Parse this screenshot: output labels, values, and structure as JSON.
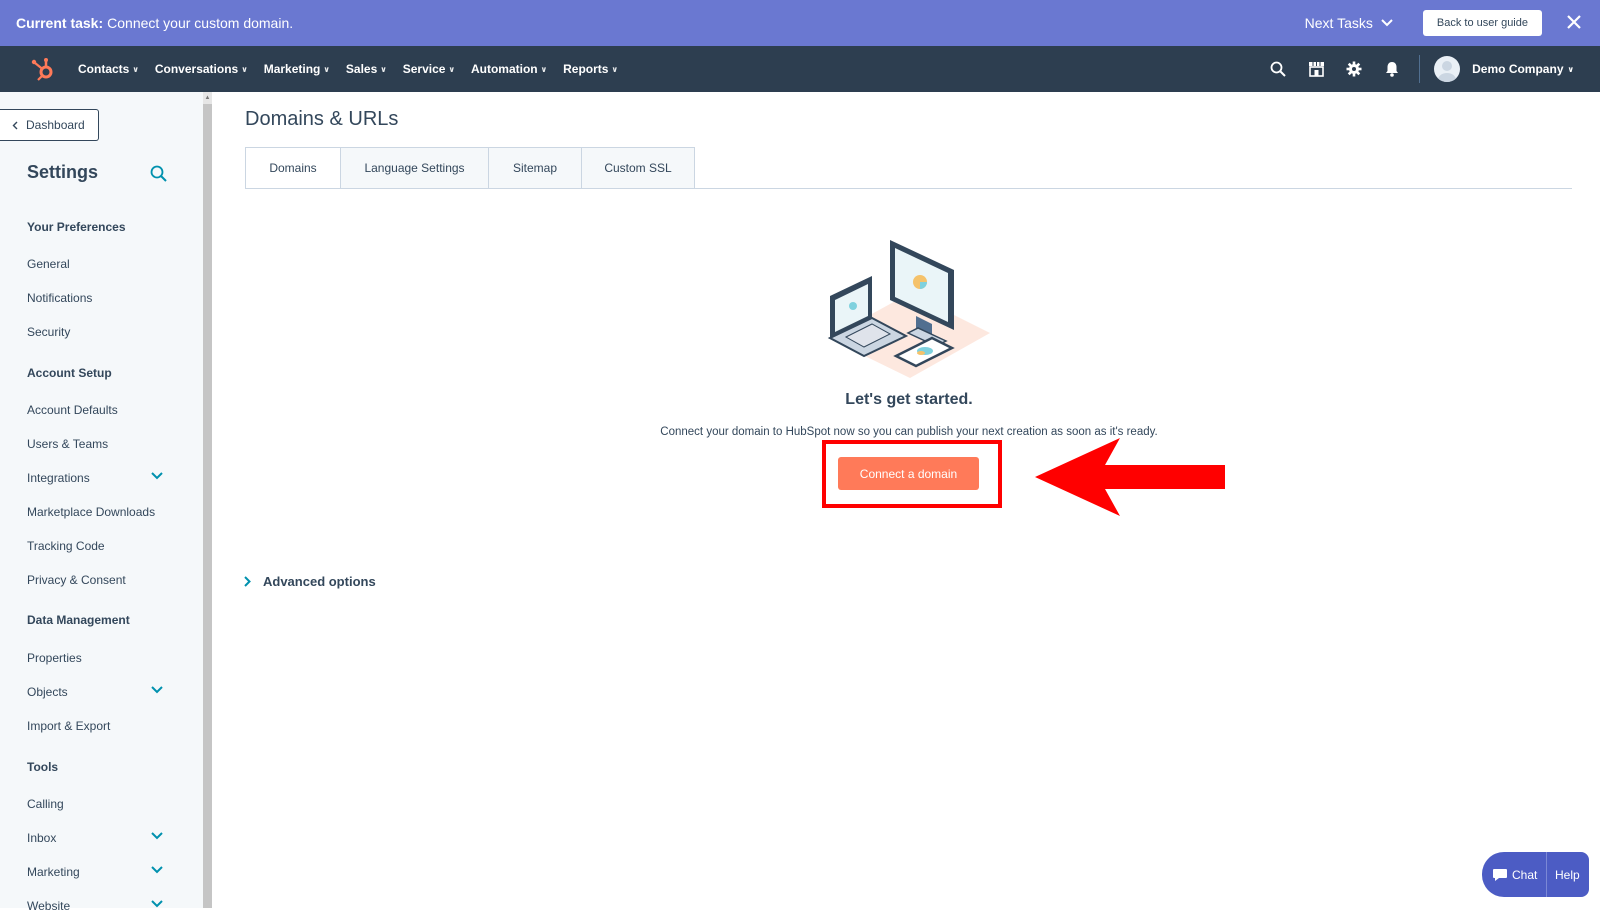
{
  "task_banner": {
    "label": "Current task:",
    "text": "Connect your custom domain.",
    "next_tasks": "Next Tasks",
    "back_button": "Back to user guide"
  },
  "topnav": {
    "items": [
      {
        "label": "Contacts"
      },
      {
        "label": "Conversations"
      },
      {
        "label": "Marketing"
      },
      {
        "label": "Sales"
      },
      {
        "label": "Service"
      },
      {
        "label": "Automation"
      },
      {
        "label": "Reports"
      }
    ],
    "account": "Demo Company"
  },
  "sidebar": {
    "dashboard_button": "Dashboard",
    "title": "Settings",
    "sections": {
      "preferences": "Your Preferences",
      "general": "General",
      "notifications": "Notifications",
      "security": "Security",
      "account_setup": "Account Setup",
      "account_defaults": "Account Defaults",
      "users_teams": "Users & Teams",
      "integrations": "Integrations",
      "marketplace": "Marketplace Downloads",
      "tracking": "Tracking Code",
      "privacy": "Privacy & Consent",
      "data_mgmt": "Data Management",
      "properties": "Properties",
      "objects": "Objects",
      "import_export": "Import & Export",
      "tools": "Tools",
      "calling": "Calling",
      "inbox": "Inbox",
      "marketing": "Marketing",
      "website": "Website"
    }
  },
  "main": {
    "title": "Domains & URLs",
    "tabs": [
      {
        "label": "Domains"
      },
      {
        "label": "Language Settings"
      },
      {
        "label": "Sitemap"
      },
      {
        "label": "Custom SSL"
      }
    ],
    "empty_state": {
      "heading": "Let's get started.",
      "description": "Connect your domain to HubSpot now so you can publish your next creation as soon as it's ready.",
      "button": "Connect a domain"
    },
    "advanced_options": "Advanced options"
  },
  "chat": {
    "chat_label": "Chat",
    "help_label": "Help"
  },
  "colors": {
    "banner": "#6a78d1",
    "nav": "#2d3e50",
    "primary_button": "#ff7a59",
    "annotation": "#ff0000"
  }
}
